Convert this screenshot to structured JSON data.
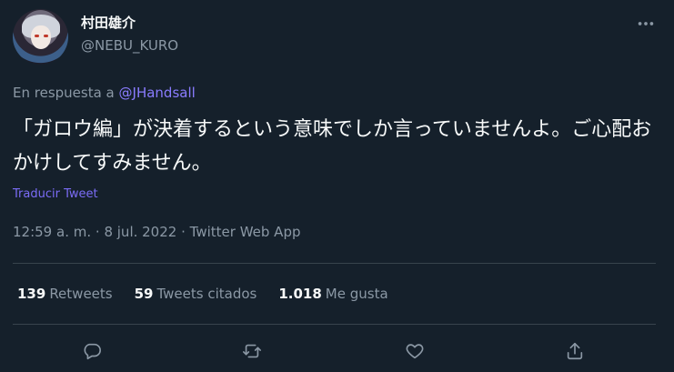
{
  "author": {
    "display_name": "村田雄介",
    "handle": "@NEBU_KURO"
  },
  "reply_context": {
    "prefix": "En respuesta a",
    "mention": "@JHandsall"
  },
  "tweet": {
    "text": "「ガロウ編」が決着するという意味でしか言っていませんよ。ご心配おかけしてすみません。",
    "translate_label": "Traducir Tweet"
  },
  "meta": {
    "time": "12:59 a. m.",
    "separator": "·",
    "date": "8 jul. 2022",
    "source": "Twitter Web App"
  },
  "stats": {
    "retweets_count": "139",
    "retweets_label": "Retweets",
    "quotes_count": "59",
    "quotes_label": "Tweets citados",
    "likes_count": "1.018",
    "likes_label": "Me gusta"
  },
  "actions": [
    "reply-icon",
    "retweet-icon",
    "like-icon",
    "share-icon"
  ],
  "colors": {
    "background": "#15202b",
    "text": "#f7f9f9",
    "secondary": "#8b98a5",
    "link": "#8a7cff",
    "divider": "#38444d"
  }
}
